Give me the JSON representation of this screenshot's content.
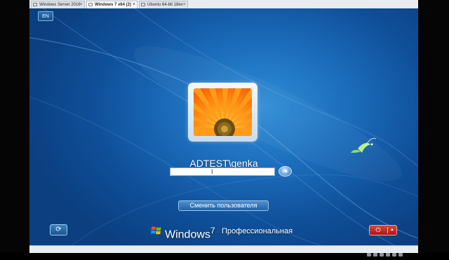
{
  "host": {
    "tabs": [
      {
        "label": "Windows Server 2016",
        "active": false
      },
      {
        "label": "Windows 7 x64 (2)",
        "active": true
      },
      {
        "label": "Ubuntu 64-bit 18ex",
        "active": false
      }
    ],
    "tab_close_glyph": "×"
  },
  "login": {
    "language_indicator": "EN",
    "username": "ADTEST\\genka",
    "password_value": "",
    "text_cursor": "I",
    "submit_glyph": "➜",
    "switch_user_label": "Сменить пользователя",
    "accessibility_glyph": "⟳",
    "power_glyph": "⏻",
    "power_menu_glyph": "▲",
    "branding": {
      "windows": "Windows",
      "version": "7",
      "edition": "Профессиональная"
    }
  },
  "colors": {
    "background_center": "#2f8ed6",
    "background_edge": "#0b3f80",
    "shutdown_red": "#c0281e",
    "flower_orange": "#ff9a1a"
  },
  "icons": {
    "submit": "arrow-right-icon",
    "accessibility": "ease-of-access-icon",
    "shutdown": "power-icon",
    "user_picture": "orange-flower-picture",
    "windows_logo": "windows-flag-logo"
  }
}
